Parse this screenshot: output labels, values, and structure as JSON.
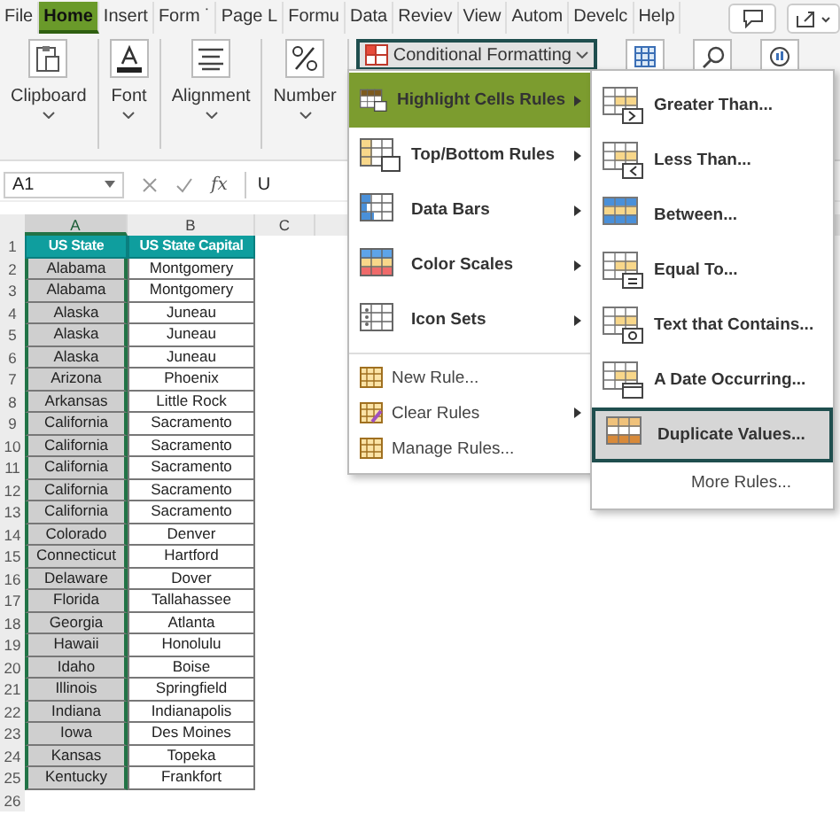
{
  "ribbon_tabs": [
    {
      "label": "File",
      "selected": false
    },
    {
      "label": "Home",
      "selected": true
    },
    {
      "label": "Insert",
      "selected": false
    },
    {
      "label": "Form ˙",
      "selected": false
    },
    {
      "label": "Page L",
      "selected": false
    },
    {
      "label": "Formu",
      "selected": false
    },
    {
      "label": "Data",
      "selected": false
    },
    {
      "label": "Reviev",
      "selected": false
    },
    {
      "label": "View",
      "selected": false
    },
    {
      "label": "Autom",
      "selected": false
    },
    {
      "label": "Develc",
      "selected": false
    },
    {
      "label": "Help",
      "selected": false
    }
  ],
  "ribbon_groups": [
    "Clipboard",
    "Font",
    "Alignment",
    "Number"
  ],
  "conditional_formatting": {
    "label": "Conditional Formatting",
    "selected": true
  },
  "formula_bar": {
    "name_box": "A1",
    "function_label": "fx",
    "formula": "U"
  },
  "sheet": {
    "columns": [
      {
        "label": "A",
        "selected": true
      },
      {
        "label": "B",
        "selected": false
      },
      {
        "label": "C",
        "selected": false
      }
    ],
    "rows": [
      {
        "number": "1",
        "kind": "header",
        "cells": [
          "US State",
          "US State Capital"
        ]
      },
      {
        "number": "2",
        "kind": "data",
        "cells": [
          "Alabama",
          "Montgomery"
        ]
      },
      {
        "number": "3",
        "kind": "data",
        "cells": [
          "Alabama",
          "Montgomery"
        ]
      },
      {
        "number": "4",
        "kind": "data",
        "cells": [
          "Alaska",
          "Juneau"
        ]
      },
      {
        "number": "5",
        "kind": "data",
        "cells": [
          "Alaska",
          "Juneau"
        ]
      },
      {
        "number": "6",
        "kind": "data",
        "cells": [
          "Alaska",
          "Juneau"
        ]
      },
      {
        "number": "7",
        "kind": "data",
        "cells": [
          "Arizona",
          "Phoenix"
        ]
      },
      {
        "number": "8",
        "kind": "data",
        "cells": [
          "Arkansas",
          "Little Rock"
        ]
      },
      {
        "number": "9",
        "kind": "data",
        "cells": [
          "California",
          "Sacramento"
        ]
      },
      {
        "number": "10",
        "kind": "data",
        "cells": [
          "California",
          "Sacramento"
        ]
      },
      {
        "number": "11",
        "kind": "data",
        "cells": [
          "California",
          "Sacramento"
        ]
      },
      {
        "number": "12",
        "kind": "data",
        "cells": [
          "California",
          "Sacramento"
        ]
      },
      {
        "number": "13",
        "kind": "data",
        "cells": [
          "California",
          "Sacramento"
        ]
      },
      {
        "number": "14",
        "kind": "data",
        "cells": [
          "Colorado",
          "Denver"
        ]
      },
      {
        "number": "15",
        "kind": "data",
        "cells": [
          "Connecticut",
          "Hartford"
        ]
      },
      {
        "number": "16",
        "kind": "data",
        "cells": [
          "Delaware",
          "Dover"
        ]
      },
      {
        "number": "17",
        "kind": "data",
        "cells": [
          "Florida",
          "Tallahassee"
        ]
      },
      {
        "number": "18",
        "kind": "data",
        "cells": [
          "Georgia",
          "Atlanta"
        ]
      },
      {
        "number": "19",
        "kind": "data",
        "cells": [
          "Hawaii",
          "Honolulu"
        ]
      },
      {
        "number": "20",
        "kind": "data",
        "cells": [
          "Idaho",
          "Boise"
        ]
      },
      {
        "number": "21",
        "kind": "data",
        "cells": [
          "Illinois",
          "Springfield"
        ]
      },
      {
        "number": "22",
        "kind": "data",
        "cells": [
          "Indiana",
          "Indianapolis"
        ]
      },
      {
        "number": "23",
        "kind": "data",
        "cells": [
          "Iowa",
          "Des Moines"
        ]
      },
      {
        "number": "24",
        "kind": "data",
        "cells": [
          "Kansas",
          "Topeka"
        ]
      },
      {
        "number": "25",
        "kind": "data",
        "cells": [
          "Kentucky",
          "Frankfort"
        ]
      },
      {
        "number": "26",
        "kind": "empty",
        "cells": []
      }
    ]
  },
  "menu": {
    "items": [
      {
        "label": "Highlight Cells Rules",
        "kind": "large",
        "has_submenu": true,
        "selected": true
      },
      {
        "label": "Top/Bottom Rules",
        "kind": "large",
        "has_submenu": true,
        "selected": false
      },
      {
        "label": "Data Bars",
        "kind": "large",
        "has_submenu": true,
        "selected": false
      },
      {
        "label": "Color Scales",
        "kind": "large",
        "has_submenu": true,
        "selected": false
      },
      {
        "label": "Icon Sets",
        "kind": "large",
        "has_submenu": true,
        "selected": false
      },
      {
        "label": "New Rule...",
        "kind": "small",
        "has_submenu": false,
        "selected": false
      },
      {
        "label": "Clear Rules",
        "kind": "small",
        "has_submenu": true,
        "selected": false
      },
      {
        "label": "Manage Rules...",
        "kind": "small",
        "has_submenu": false,
        "selected": false
      }
    ]
  },
  "submenu": {
    "items": [
      {
        "label": "Greater Than...",
        "kind": "large",
        "selected": false
      },
      {
        "label": "Less Than...",
        "kind": "large",
        "selected": false
      },
      {
        "label": "Between...",
        "kind": "large",
        "selected": false
      },
      {
        "label": "Equal To...",
        "kind": "large",
        "selected": false
      },
      {
        "label": "Text that Contains...",
        "kind": "large",
        "selected": false
      },
      {
        "label": "A Date Occurring...",
        "kind": "large",
        "selected": false
      },
      {
        "label": "Duplicate Values...",
        "kind": "large",
        "selected": true
      },
      {
        "label": "More Rules...",
        "kind": "plain",
        "selected": false
      }
    ]
  }
}
